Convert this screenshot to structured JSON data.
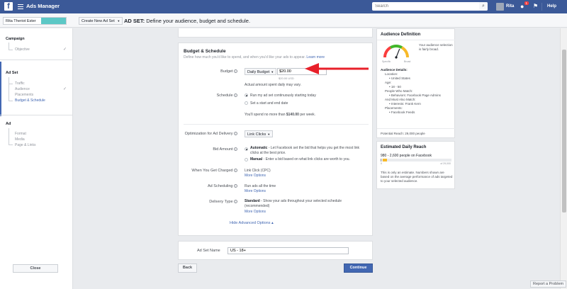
{
  "topbar": {
    "fb_glyph": "f",
    "title": "Ads Manager",
    "search_placeholder": "Search",
    "search_icon_glyph": "⌕",
    "user_name": "Rita",
    "notif_count": "1",
    "globe_glyph": "●",
    "flag_glyph": "⚑",
    "help": "Help",
    "brand_color": "#3b5998"
  },
  "subbar": {
    "account": "Rita Theriot Ester",
    "create_button": "Create New Ad Set",
    "caret": "▼",
    "heading_bold": "AD SET:",
    "heading_text": " Define your audience, budget and schedule."
  },
  "sidebar": {
    "campaign": {
      "title": "Campaign",
      "items": [
        "Objective"
      ]
    },
    "adset": {
      "title": "Ad Set",
      "items": [
        "Traffic",
        "Audience",
        "Placements",
        "Budget & Schedule"
      ]
    },
    "ad": {
      "title": "Ad",
      "items": [
        "Format",
        "Media",
        "Page & Links"
      ]
    },
    "check_glyph": "✓",
    "close": "Close"
  },
  "budget": {
    "heading": "Budget & Schedule",
    "subheading": "Define how much you'd like to spend, and when you'd like your ads to appear.",
    "learn_more": "Learn more",
    "budget_label": "Budget",
    "budget_type": "Daily Budget",
    "budget_value": "$20.00",
    "budget_usd": "$20.00 USD",
    "actual_note": "Actual amount spent daily may vary.",
    "schedule_label": "Schedule",
    "schedule_opt1": "Run my ad set continuously starting today",
    "schedule_opt2": "Set a start and end date",
    "spend_note_pre": "You'll spend no more than ",
    "spend_note_amt": "$140.00",
    "spend_note_post": " per week.",
    "opt_label": "Optimization for Ad Delivery",
    "opt_value": "Link Clicks",
    "bid_label": "Bid Amount",
    "bid_auto_title": "Automatic",
    "bid_auto_text": " - Let Facebook set the bid that helps you get the most link clicks at the best price.",
    "bid_manual_title": "Manual",
    "bid_manual_text": " - Enter a bid based on what link clicks are worth to you.",
    "charged_label": "When You Get Charged",
    "charged_value": "Link Click (CPC)",
    "more_options": "More Options",
    "scheduling_label": "Ad Scheduling",
    "scheduling_value": "Run ads all the time",
    "delivery_label": "Delivery Type",
    "delivery_value_bold": "Standard",
    "delivery_value_text": " - Show your ads throughout your selected schedule (recommended)",
    "hide_advanced": "Hide Advanced Options ▴",
    "info_glyph": "i"
  },
  "adset_name": {
    "label": "Ad Set Name",
    "value": "US - 18+"
  },
  "buttons": {
    "back": "Back",
    "continue": "Continue"
  },
  "audience": {
    "title": "Audience Definition",
    "gauge_left": "Specific",
    "gauge_right": "Broad",
    "gauge_level": 0.62,
    "gauge_text": "Your audience selection is fairly broad.",
    "details_title": "Audience Details:",
    "details": [
      {
        "head": "Location:",
        "items": [
          "United States"
        ]
      },
      {
        "head": "Age:",
        "items": [
          "18 - 50"
        ]
      },
      {
        "head": "People Who Match:",
        "items": [
          "Behaviors: Facebook Page Admins"
        ]
      },
      {
        "head": "And Must Also Match:",
        "items": [
          "Interests: Frank Kern"
        ]
      },
      {
        "head": "Placements:",
        "items": [
          "Facebook Feeds"
        ]
      }
    ],
    "potential": "Potential Reach: 29,000 people"
  },
  "estimate": {
    "title": "Estimated Daily Reach",
    "range": "980 - 2,600 people on Facebook",
    "scale_left": "0",
    "scale_right": "of 29,000",
    "fill_start": 0.034,
    "fill_end": 0.09,
    "note": "This is only an estimate. Numbers shown are based on the average performance of ads targeted to your selected audience."
  },
  "footer": {
    "report": "Report a Problem"
  },
  "colors": {
    "accent": "#4267b2",
    "arrow": "#e8202a",
    "gauge_teal": "#5cc8c6"
  }
}
